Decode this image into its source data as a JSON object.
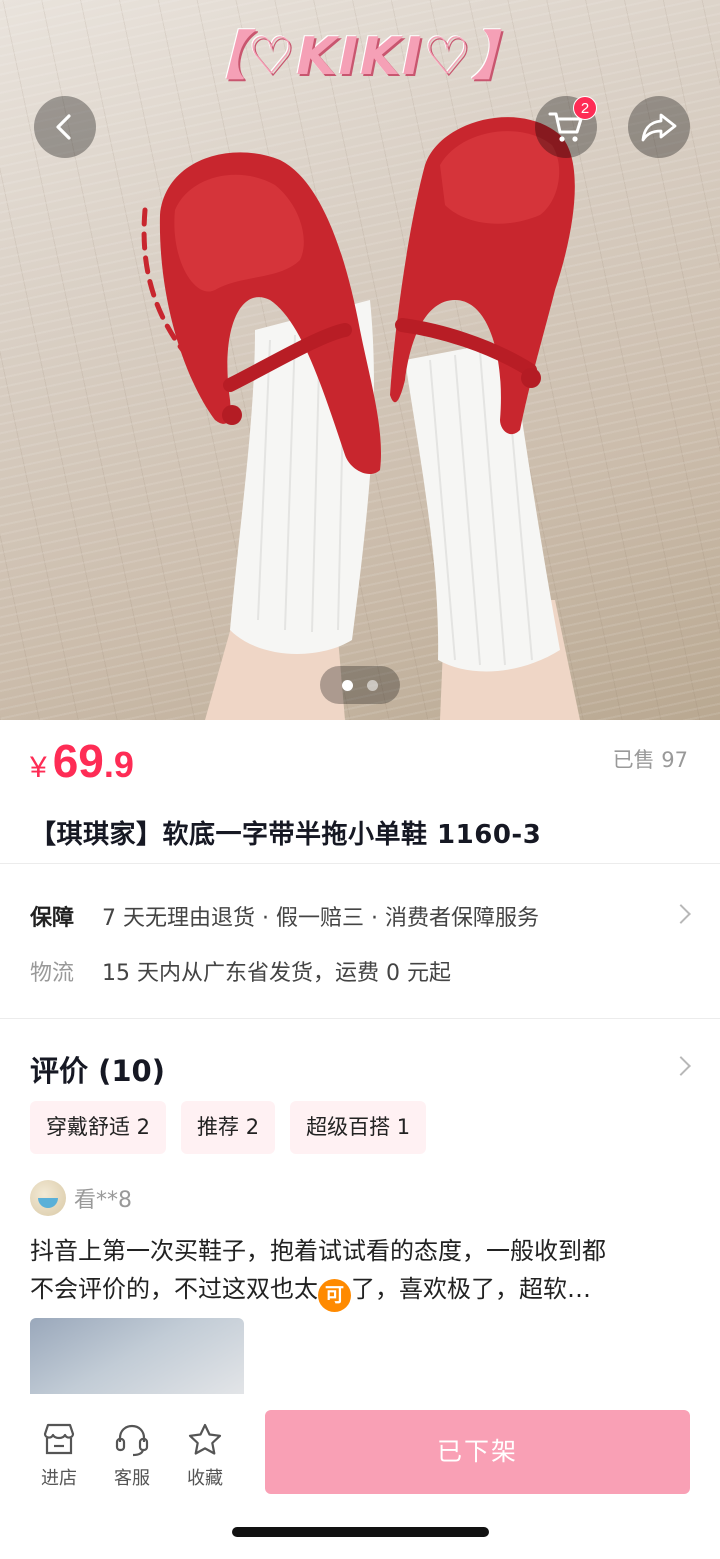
{
  "hero": {
    "watermark": "【♡KIKI♡】",
    "cart_badge": "2",
    "carousel": {
      "count": 2,
      "active_index": 0
    }
  },
  "product": {
    "currency": "¥",
    "price_int": "69",
    "price_dec": ".9",
    "sold_label": "已售 97",
    "title": "【琪琪家】软底一字带半拖小单鞋 1160-3"
  },
  "service": {
    "guarantee_label": "保障",
    "guarantee_text": "7 天无理由退货 · 假一赔三 · 消费者保障服务",
    "logistics_label": "物流",
    "logistics_text": "15 天内从广东省发货，运费 0 元起"
  },
  "reviews": {
    "heading": "评价 (10)",
    "tags": [
      "穿戴舒适 2",
      "推荐 2",
      "超级百搭 1"
    ],
    "first": {
      "username": "看**8",
      "line1": "抖音上第一次买鞋子，抱着试试看的态度，一般收到都",
      "line2_before": "不会评价的，不过这双也太",
      "emoji_text": "可",
      "line2_after": "了，喜欢极了，超软…"
    }
  },
  "bottom_bar": {
    "store_label": "进店",
    "service_label": "客服",
    "favorite_label": "收藏",
    "buy_label": "已下架"
  },
  "colors": {
    "accent": "#fe2c55",
    "buy_button": "#f9a0b5",
    "tag_bg": "#fff1f3"
  },
  "icons": [
    "back-arrow-icon",
    "cart-icon",
    "share-icon",
    "store-icon",
    "headset-icon",
    "star-icon"
  ]
}
